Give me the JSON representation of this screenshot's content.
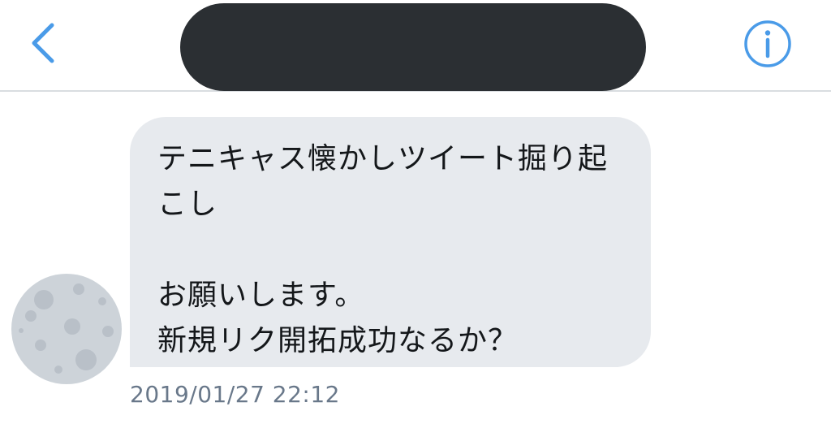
{
  "header": {
    "back_icon": "chevron-left-icon",
    "info_icon": "info-circle-icon",
    "accent_color": "#4a9be8",
    "title_redacted": true
  },
  "conversation": {
    "avatar_icon": "moon-avatar",
    "message": {
      "lines": [
        "テニキャス懐かしツイート掘り起",
        "こし",
        "",
        "お願いします。",
        "新規リク開拓成功なるか？"
      ],
      "timestamp": "2019/01/27 22:12"
    }
  }
}
